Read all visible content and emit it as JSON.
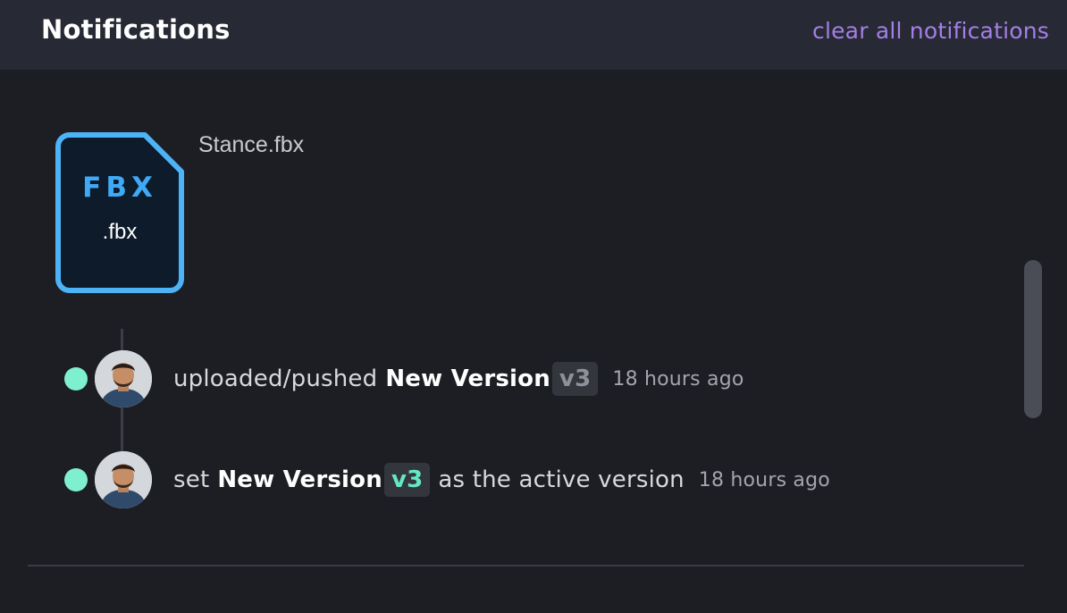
{
  "header": {
    "title": "Notifications",
    "clear_label": "clear all notifications"
  },
  "file": {
    "ext_big": "FBX",
    "ext_small": ".fbx",
    "name": "Stance.fbx",
    "icon": "fbx-file-icon",
    "accent_color": "#3fa9f5"
  },
  "activities": [
    {
      "text_before": "uploaded/pushed",
      "bold": "New Version",
      "version": "v3",
      "text_after": "",
      "time": "18 hours ago",
      "version_color": "#8f9099"
    },
    {
      "text_before": "set",
      "bold": "New Version",
      "version": "v3",
      "text_after": "as the active version",
      "time": "18 hours ago",
      "version_color": "#64e8c4"
    }
  ],
  "colors": {
    "status_dot": "#7ef0cf",
    "link": "#a57ee8",
    "background": "#1d1e23",
    "header_bg": "#272a34"
  }
}
